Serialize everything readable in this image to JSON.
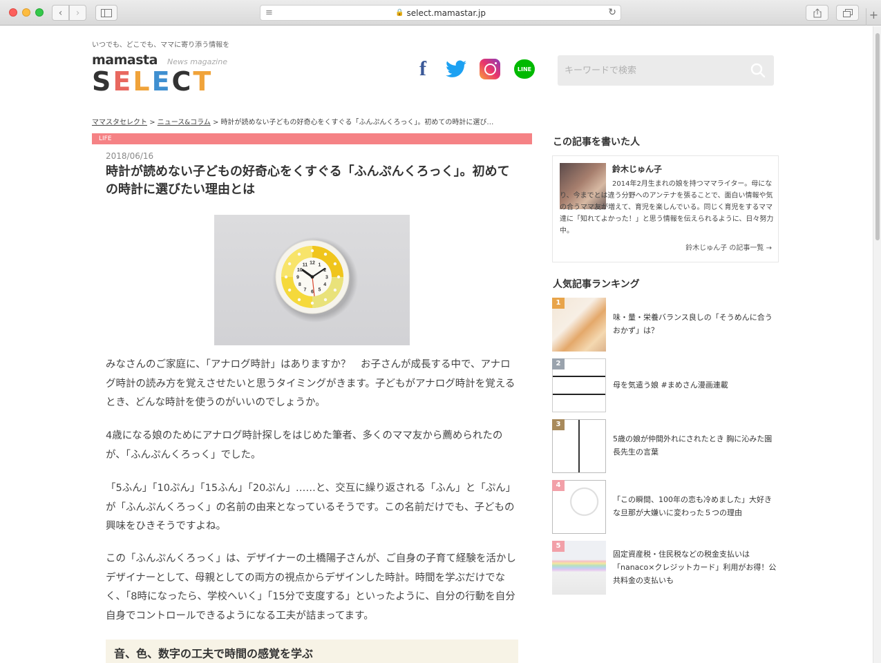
{
  "browser": {
    "url": "select.mamastar.jp"
  },
  "header": {
    "tagline": "いつでも、どこでも、ママに寄り添う情報を",
    "logo_top": "mamasta",
    "logo_sub": "News magazine",
    "logo_main_letters": [
      "S",
      "E",
      "L",
      "E",
      "C",
      "T"
    ],
    "logo_main_colors": [
      "#333333",
      "#e8685f",
      "#f0a33a",
      "#3f8fd0",
      "#333333",
      "#f0a33a"
    ],
    "social": {
      "facebook": "f",
      "line": "LINE"
    },
    "search_placeholder": "キーワードで検索"
  },
  "breadcrumb": {
    "items": [
      "ママスタセレクト",
      "ニュース&コラム"
    ],
    "separator": ">",
    "current": "時計が読めない子どもの好奇心をくすぐる「ふんぷんくろっく」。初めての時計に選び…"
  },
  "article": {
    "category": "LIFE",
    "date": "2018/06/16",
    "title": "時計が読めない子どもの好奇心をくすぐる「ふんぷんくろっく」。初めての時計に選びたい理由とは",
    "paragraphs": [
      "みなさんのご家庭に、「アナログ時計」はありますか？　お子さんが成長する中で、アナログ時計の読み方を覚えさせたいと思うタイミングがきます。子どもがアナログ時計を覚えるとき、どんな時計を使うのがいいのでしょうか。",
      "4歳になる娘のためにアナログ時計探しをはじめた筆者、多くのママ友から薦められたのが、「ふんぷんくろっく」でした。",
      "「5ふん」「10ぷん」「15ふん」「20ぷん」……と、交互に繰り返される「ふん」と「ぷん」が「ふんぷんくろっく」の名前の由来となっているそうです。この名前だけでも、子どもの興味をひきそうですよね。",
      "この「ふんぷんくろっく」は、デザイナーの土橋陽子さんが、ご自身の子育て経験を活かしデザイナーとして、母親としての両方の視点からデザインした時計。時間を学ぶだけでなく、「8時になったら、学校へいく」「15分で支度する」といったように、自分の行動を自分自身でコントロールできるようになる工夫が詰まってます。"
    ],
    "subheading": "音、色、数字の工夫で時間の感覚を学ぶ",
    "clock_numbers": [
      "12",
      "1",
      "2",
      "3",
      "4",
      "5",
      "6",
      "7",
      "8",
      "9",
      "10",
      "11"
    ]
  },
  "sidebar": {
    "author_heading": "この記事を書いた人",
    "author_name": "鈴木じゅん子",
    "author_bio": "2014年2月生まれの娘を持つママライター。母になり、今までとは違う分野へのアンテナを張ることで、面白い情報や気の合うママ友が増えて、育児を楽しんでいる。同じく育児をするママ達に「知れてよかった！」と思う情報を伝えられるように、日々努力中。",
    "author_link": "鈴木じゅん子 の記事一覧 →",
    "ranking_heading": "人気記事ランキング",
    "ranking": [
      {
        "rank": "1",
        "title": "味・量・栄養バランス良しの「そうめんに合うおかず」は？",
        "badge_color": "#e8a44a"
      },
      {
        "rank": "2",
        "title": "母を気遣う娘 #まめさん漫画連載",
        "badge_color": "#9aa3ad"
      },
      {
        "rank": "3",
        "title": "5歳の娘が仲間外れにされたとき 胸に沁みた園長先生の言葉",
        "badge_color": "#a88a5c"
      },
      {
        "rank": "4",
        "title": "「この瞬間、100年の恋も冷めました」大好きな旦那が大嫌いに変わった５つの理由",
        "badge_color": "#f2a0a8"
      },
      {
        "rank": "5",
        "title": "固定資産税・住民税などの税金支払いは「nanaco×クレジットカード」利用がお得！公共料金の支払いも",
        "badge_color": "#f2a0a8"
      }
    ]
  }
}
